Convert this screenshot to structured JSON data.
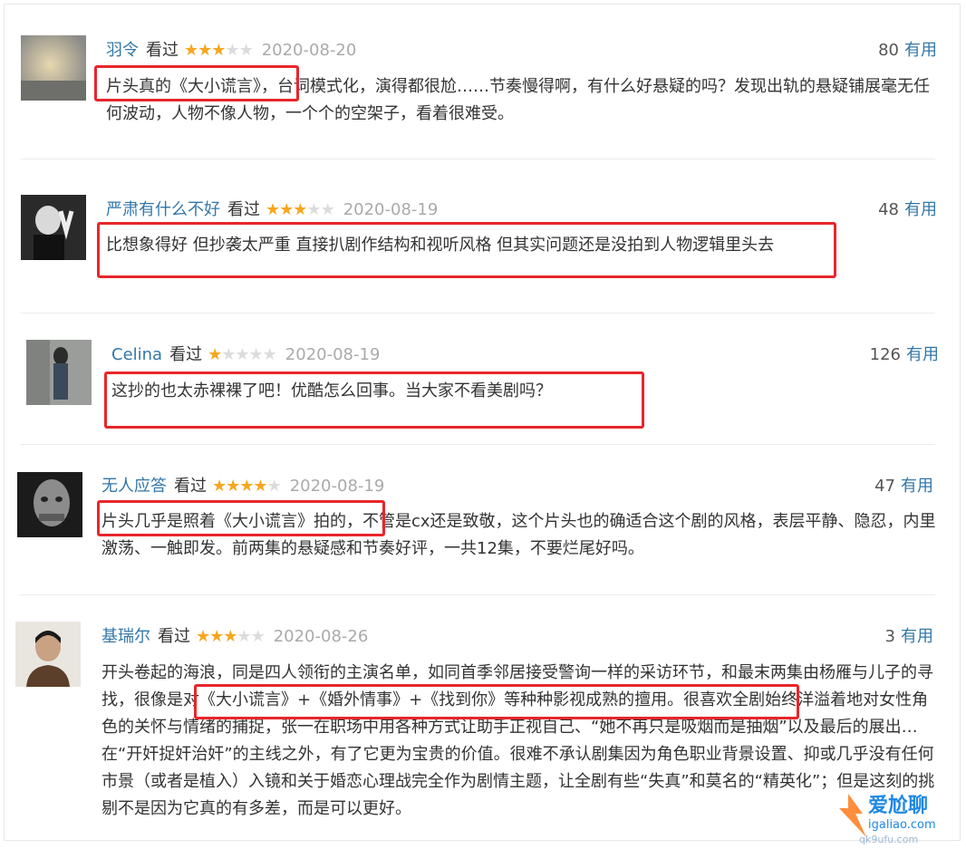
{
  "reviews": [
    {
      "user": "羽令",
      "status": "看过",
      "rating": 3,
      "date": "2020-08-20",
      "votes": "80",
      "useful_label": "有用",
      "content": "片头真的《大小谎言》，台词模式化，演得都很尬……节奏慢得啊，有什么好悬疑的吗？发现出轨的悬疑铺展毫无任何波动，人物不像人物，一个个的空架子，看着很难受。"
    },
    {
      "user": "严肃有什么不好",
      "status": "看过",
      "rating": 3,
      "date": "2020-08-19",
      "votes": "48",
      "useful_label": "有用",
      "content": "比想象得好 但抄袭太严重 直接扒剧作结构和视听风格 但其实问题还是没拍到人物逻辑里头去"
    },
    {
      "user": "Celina",
      "status": "看过",
      "rating": 1,
      "date": "2020-08-19",
      "votes": "126",
      "useful_label": "有用",
      "content": "这抄的也太赤裸裸了吧！优酷怎么回事。当大家不看美剧吗？"
    },
    {
      "user": "无人应答",
      "status": "看过",
      "rating": 4,
      "date": "2020-08-19",
      "votes": "47",
      "useful_label": "有用",
      "content": "片头几乎是照着《大小谎言》拍的，不管是cx还是致敬，这个片头也的确适合这个剧的风格，表层平静、隐忍，内里激荡、一触即发。前两集的悬疑感和节奏好评，一共12集，不要烂尾好吗。"
    },
    {
      "user": "基瑞尔",
      "status": "看过",
      "rating": 3,
      "date": "2020-08-26",
      "votes": "3",
      "useful_label": "有用",
      "content": "开头卷起的海浪，同是四人领衔的主演名单，如同首季邻居接受警询一样的采访环节，和最末两集由杨雁与儿子的寻找，很像是对《大小谎言》+《婚外情事》+《找到你》等种种影视成熟的擅用。很喜欢全剧始终洋溢着地对女性角色的关怀与情绪的捕捉，张一在职场中用各种方式让助手正视自己、“她不再只是吸烟而是抽烟”以及最后的展出…在“开奸捉奸治奸”的主线之外，有了它更为宝贵的价值。很难不承认剧集因为角色职业背景设置、抑或几乎没有任何市景（或者是植入）入镜和关于婚恋心理战完全作为剧情主题，让全剧有些“失真”和莫名的“精英化”；但是这刻的挑剔不是因为它真的有多差，而是可以更好。"
    }
  ],
  "watermark": {
    "line1": "爱尬聊",
    "line2": "igaliao.com",
    "line3": "qk9ufu.com"
  },
  "colors": {
    "username": "#3377aa",
    "star": "#f7a61f",
    "highlight": "#e8262b",
    "date": "#aaaaaa"
  }
}
